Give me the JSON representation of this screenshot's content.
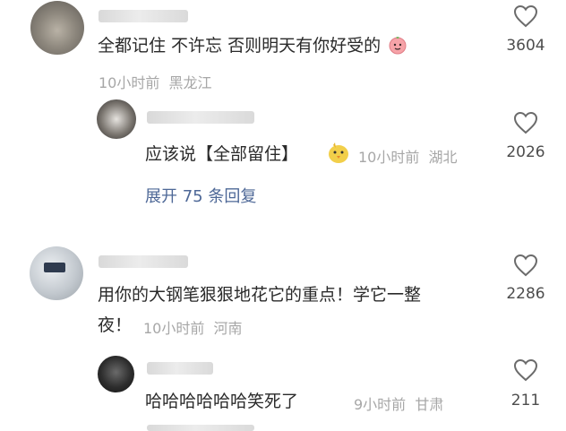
{
  "comments": [
    {
      "text": "全都记住 不许忘 否则明天有你好受的",
      "time": "10小时前",
      "location": "黑龙江",
      "likes": "3604",
      "emoji": "peach-face-emoji"
    },
    {
      "text": "应该说【全部留住】",
      "time": "10小时前",
      "location": "湖北",
      "likes": "2026",
      "emoji": "yellow-bird-emoji"
    },
    {
      "text_line1": "用你的大钢笔狠狠地花它的重点！学它一整",
      "text_line2": "夜！",
      "time": "10小时前",
      "location": "河南",
      "likes": "2286"
    },
    {
      "text": "哈哈哈哈哈哈笑死了",
      "time": "9小时前",
      "location": "甘肃",
      "likes": "211"
    }
  ],
  "expand_replies": "展开 75 条回复",
  "icons": {
    "like": "heart-outline-icon"
  },
  "colors": {
    "link": "#4e6897",
    "meta": "#a7a7a7",
    "text": "#2a2a2a"
  }
}
